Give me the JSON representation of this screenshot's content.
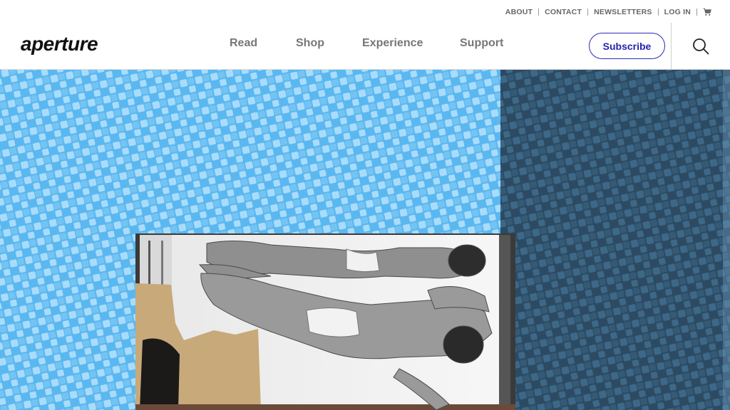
{
  "header": {
    "logo": "aperture",
    "utility_nav": [
      "ABOUT",
      "CONTACT",
      "NEWSLETTERS",
      "LOG IN"
    ],
    "cart_icon": "shopping-cart-icon",
    "main_nav": [
      "Read",
      "Shop",
      "Experience",
      "Support"
    ],
    "subscribe_label": "Subscribe",
    "search_icon": "search-icon"
  },
  "colors": {
    "accent": "#2b2bb5",
    "nav_text": "#777777",
    "hero_light_blue": "#5ab7f0",
    "hero_dark_blue": "#2c4b63"
  }
}
